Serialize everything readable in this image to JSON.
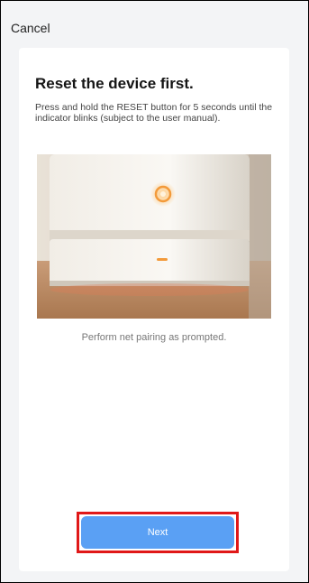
{
  "header": {
    "cancel_label": "Cancel"
  },
  "content": {
    "title": "Reset the device first.",
    "description": "Press and hold the RESET button for 5 seconds until the indicator blinks (subject to the user manual).",
    "caption": "Perform net pairing as prompted."
  },
  "footer": {
    "next_label": "Next"
  },
  "colors": {
    "background": "#f3f4f6",
    "primary_button": "#5aa0f4",
    "indicator_light": "#f39a3a",
    "highlight_box": "#e01818"
  },
  "icons": {
    "device_image": "router-reset-photo"
  }
}
